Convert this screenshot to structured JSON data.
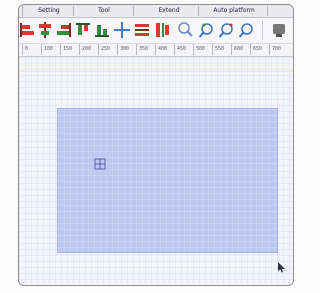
{
  "menu": {
    "items": [
      "Setting",
      "Tool",
      "Extend",
      "Auto platform"
    ]
  },
  "toolbar": {
    "tools": [
      {
        "name": "align-left-icon",
        "color": "#d23b2d"
      },
      {
        "name": "align-center-v-icon",
        "color": "#d23b2d"
      },
      {
        "name": "align-right-icon",
        "color": "#c0392b"
      },
      {
        "name": "align-top-icon",
        "color": "#2f8f3a"
      },
      {
        "name": "align-bottom-icon",
        "color": "#2f8f3a"
      },
      {
        "name": "crosshair-icon",
        "color": "#4a78c8"
      },
      {
        "name": "distribute-h-icon",
        "color": "#d23b2d"
      },
      {
        "name": "distribute-v-icon",
        "color": "#d23b2d"
      },
      {
        "name": "zoom-icon",
        "color": "#3a73c4"
      },
      {
        "name": "zoom-in-icon",
        "color": "#3a73c4"
      },
      {
        "name": "zoom-out-icon",
        "color": "#3a73c4"
      },
      {
        "name": "zoom-fit-icon",
        "color": "#3a73c4"
      },
      {
        "name": "pan-tool-icon",
        "color": "#555555"
      }
    ]
  },
  "ruler": {
    "labels": [
      "0",
      "100",
      "150",
      "200",
      "250",
      "300",
      "350",
      "400",
      "450",
      "500",
      "550",
      "600",
      "650",
      "700"
    ]
  },
  "canvas": {
    "selection_color": "#bcc8f0",
    "guide_color": "#f2ef9c"
  }
}
